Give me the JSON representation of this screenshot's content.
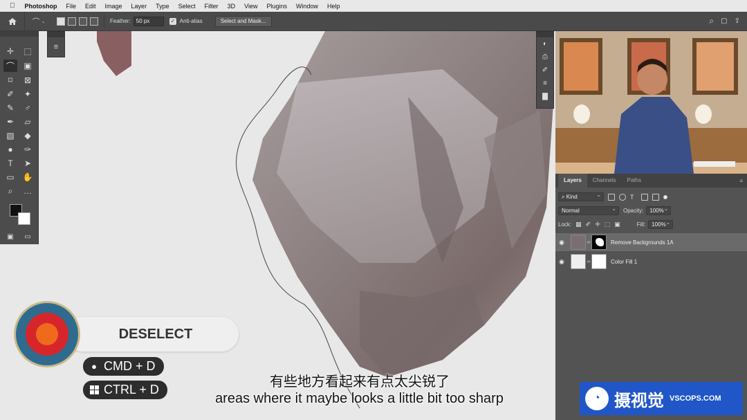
{
  "menubar": {
    "apple": "",
    "app": "Photoshop",
    "items": [
      "File",
      "Edit",
      "Image",
      "Layer",
      "Type",
      "Select",
      "Filter",
      "3D",
      "View",
      "Plugins",
      "Window",
      "Help"
    ]
  },
  "options": {
    "feather_label": "Feather:",
    "feather_value": "50 px",
    "antialias_label": "Anti-alias",
    "select_mask_label": "Select and Mask..."
  },
  "layers_panel": {
    "tabs": [
      "Layers",
      "Channels",
      "Paths"
    ],
    "filter_kind": "Kind",
    "blend_mode": "Normal",
    "opacity_label": "Opacity:",
    "opacity_value": "100%",
    "lock_label": "Lock:",
    "fill_label": "Fill:",
    "fill_value": "100%",
    "layers": [
      {
        "name": "Remove Backgrounds 1A"
      },
      {
        "name": "Color Fill 1"
      }
    ]
  },
  "overlay": {
    "deselect_label": "DESELECT",
    "mac_shortcut": "CMD + D",
    "win_shortcut": "CTRL + D"
  },
  "subtitles": {
    "chinese": "有些地方看起来有点太尖锐了",
    "english": "areas where it maybe looks a little bit too sharp"
  },
  "watermark": {
    "cn": "摄视觉",
    "en": "VSCOPS.COM"
  },
  "colors": {
    "target_outer": "#2f6b8f",
    "target_mid": "#d6262b",
    "target_inner": "#ef6a1c",
    "watermark_bg": "#2056c8"
  }
}
